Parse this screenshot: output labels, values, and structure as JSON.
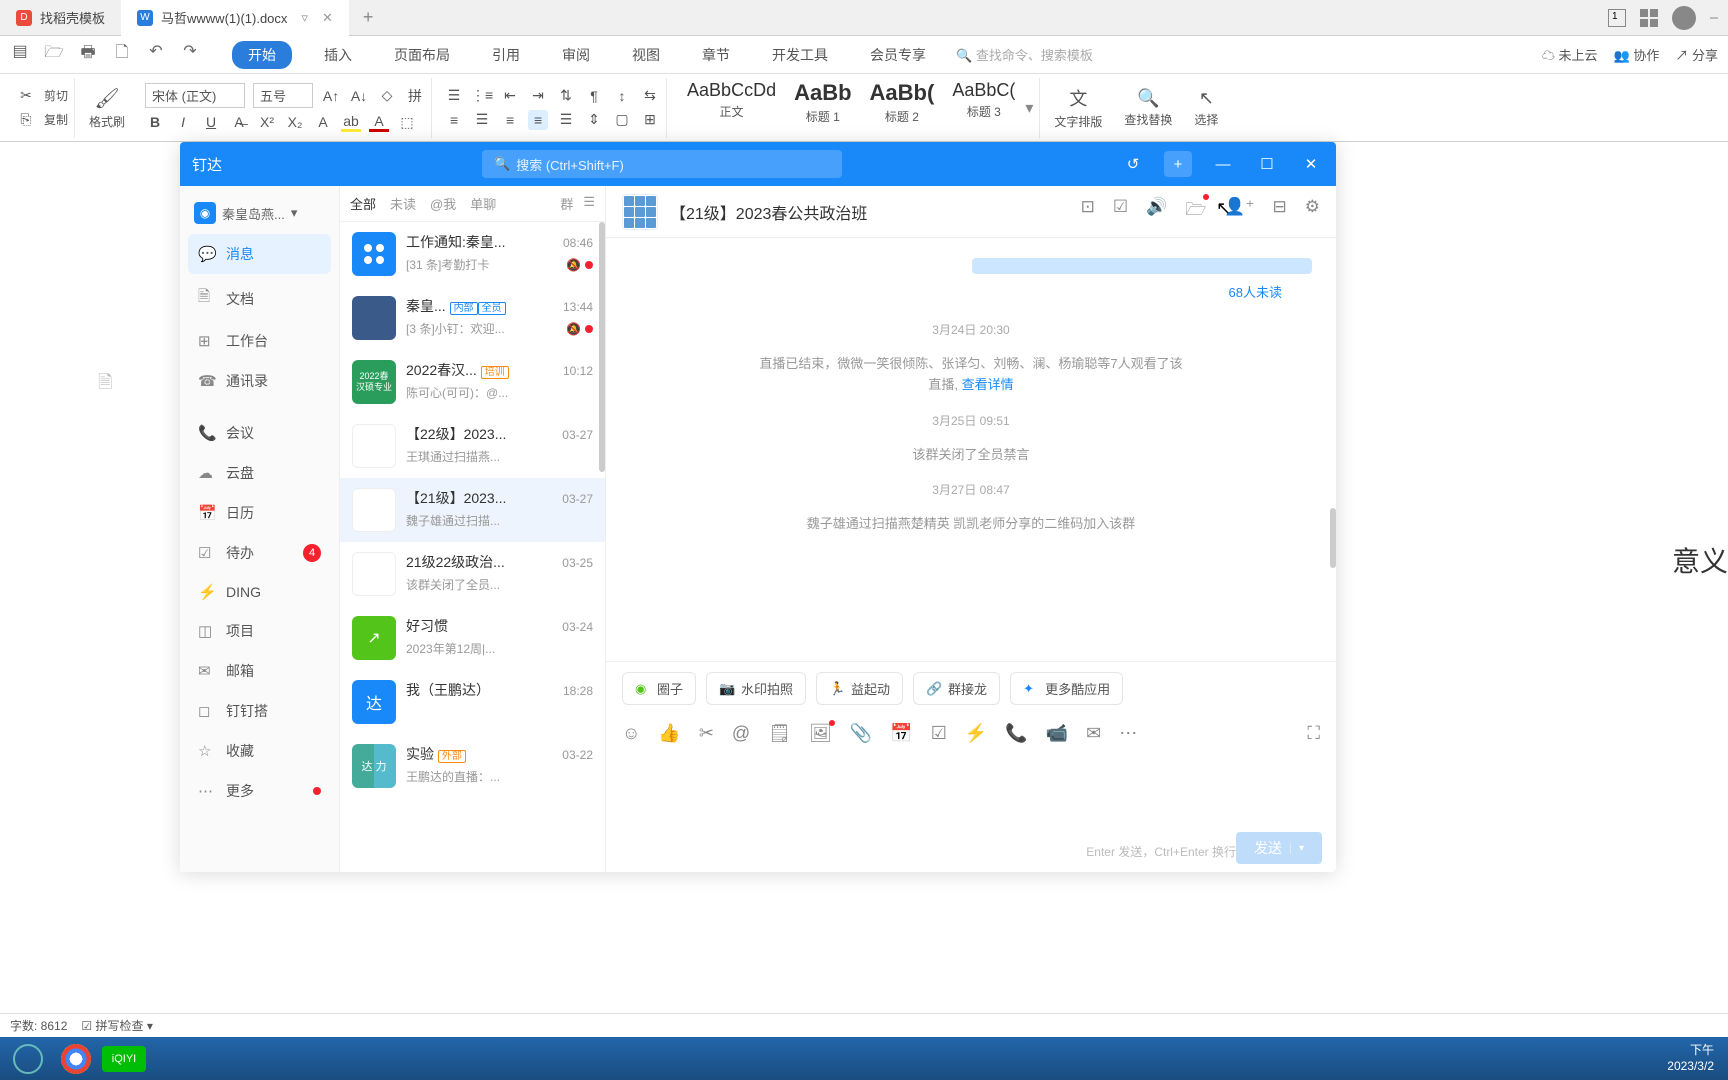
{
  "tabs": {
    "tab1": "找稻壳模板",
    "tab2": "马哲wwww(1)(1).docx"
  },
  "menu": {
    "start": "开始",
    "insert": "插入",
    "layout": "页面布局",
    "ref": "引用",
    "review": "审阅",
    "view": "视图",
    "chapter": "章节",
    "dev": "开发工具",
    "member": "会员专享",
    "search_placeholder": "查找命令、搜索模板",
    "cloud": "未上云",
    "collab": "协作",
    "share": "分享"
  },
  "ribbon": {
    "cut": "剪切",
    "copy": "复制",
    "format_painter": "格式刷",
    "font": "宋体 (正文)",
    "size": "五号",
    "style_body_preview": "AaBbCcDd",
    "style_body": "正文",
    "style_h1_preview": "AaBb",
    "style_h1": "标题 1",
    "style_h2_preview": "AaBb(",
    "style_h2": "标题 2",
    "style_h3_preview": "AaBbC(",
    "style_h3": "标题 3",
    "text_layout": "文字排版",
    "find_replace": "查找替换",
    "select": "选择"
  },
  "chat": {
    "app_name": "钉达",
    "search_placeholder": "搜索 (Ctrl+Shift+F)",
    "org": "秦皇岛燕...",
    "nav": {
      "messages": "消息",
      "docs": "文档",
      "workbench": "工作台",
      "contacts": "通讯录",
      "meeting": "会议",
      "drive": "云盘",
      "calendar": "日历",
      "todo": "待办",
      "todo_count": "4",
      "ding": "DING",
      "project": "项目",
      "mail": "邮箱",
      "dingda": "钉钉搭",
      "favorite": "收藏",
      "more": "更多"
    },
    "conv_tabs": {
      "all": "全部",
      "unread": "未读",
      "at_me": "@我",
      "single": "单聊",
      "group": "群"
    },
    "conversations": [
      {
        "name": "工作通知:秦皇...",
        "msg": "[31 条]考勤打卡",
        "time": "08:46",
        "muted": true,
        "dot": true,
        "avatar": "app"
      },
      {
        "name": "秦皇...",
        "tags": [
          "内部",
          "全员"
        ],
        "msg": "[3 条]小钉：欢迎...",
        "time": "13:44",
        "muted": true,
        "dot": true,
        "avatar": "img"
      },
      {
        "name": "2022春汉...",
        "tags_orange": [
          "培训"
        ],
        "msg": "陈可心(可可)：@...",
        "time": "10:12",
        "avatar": "green2022"
      },
      {
        "name": "【22级】2023...",
        "msg": "王琪通过扫描燕...",
        "time": "03-27",
        "avatar": "grid3"
      },
      {
        "name": "【21级】2023...",
        "msg": "魏子雄通过扫描...",
        "time": "03-27",
        "avatar": "grid3",
        "active": true
      },
      {
        "name": "21级22级政治...",
        "msg": "该群关闭了全员...",
        "time": "03-25",
        "avatar": "grid3b"
      },
      {
        "name": "好习惯",
        "msg": "2023年第12周|...",
        "time": "03-24",
        "avatar": "green"
      },
      {
        "name": "我（王鹏达）",
        "msg": "",
        "time": "18:28",
        "avatar": "blue-da"
      },
      {
        "name": "实验",
        "tags_orange": [
          "外部"
        ],
        "msg": "王鹏达的直播：...",
        "time": "03-22",
        "avatar": "split"
      }
    ],
    "header_title": "【21级】2023春公共政治班",
    "unread_text": "68人未读",
    "messages": {
      "t1": "3月24日 20:30",
      "m1": "直播已结束，微微一笑很倾陈、张译匀、刘畅、澜、杨瑜聪等7人观看了该",
      "m1b": "直播,",
      "m1_link": "查看详情",
      "t2": "3月25日 09:51",
      "m2": "该群关闭了全员禁言",
      "t3": "3月27日 08:47",
      "m3": "魏子雄通过扫描燕楚精英 凯凯老师分享的二维码加入该群"
    },
    "quickapps": {
      "circle": "圈子",
      "watermark": "水印拍照",
      "yiqidong": "益起动",
      "jielong": "群接龙",
      "more": "更多酷应用"
    },
    "input_hint": "Enter 发送，Ctrl+Enter 换行",
    "send": "发送"
  },
  "doc_behind": "意义",
  "status": {
    "words": "字数: 8612",
    "spell": "拼写检查"
  },
  "taskbar": {
    "iqiyi": "iQIYI",
    "time": "下午",
    "date": "2023/3/2"
  }
}
